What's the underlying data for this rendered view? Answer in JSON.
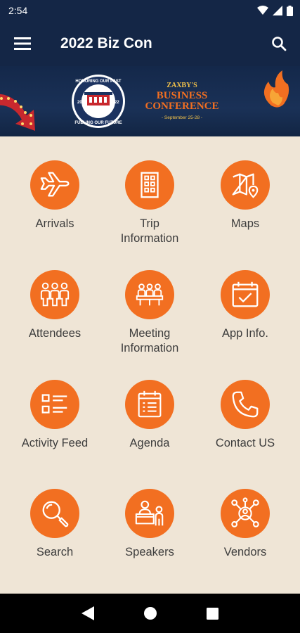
{
  "status_bar": {
    "time": "2:54",
    "icons": [
      "wifi-icon",
      "signal-icon",
      "battery-icon"
    ]
  },
  "app_bar": {
    "title": "2022 Biz Con",
    "menu_icon": "menu-icon",
    "search_icon": "search-icon"
  },
  "banner": {
    "seal_top_text": "HONORING OUR PAST",
    "seal_bottom_text": "FUELING OUR FUTURE",
    "seal_year_left": "20",
    "seal_year_right": "22",
    "brand": "ZAXBY'S",
    "line1": "BUSINESS",
    "line2": "CONFERENCE",
    "dates": "- September 25-28 -"
  },
  "colors": {
    "accent": "#f26f21",
    "header": "#142646",
    "background": "#efe5d6"
  },
  "tiles": [
    {
      "label": "Arrivals",
      "icon": "airplane-icon"
    },
    {
      "label": "Trip\nInformation",
      "icon": "building-icon"
    },
    {
      "label": "Maps",
      "icon": "map-icon"
    },
    {
      "label": "Attendees",
      "icon": "people-icon"
    },
    {
      "label": "Meeting\nInformation",
      "icon": "meeting-icon"
    },
    {
      "label": "App Info.",
      "icon": "calendar-check-icon"
    },
    {
      "label": "Activity Feed",
      "icon": "list-icon"
    },
    {
      "label": "Agenda",
      "icon": "agenda-icon"
    },
    {
      "label": "Contact US",
      "icon": "phone-icon"
    },
    {
      "label": "Search",
      "icon": "magnifier-icon"
    },
    {
      "label": "Speakers",
      "icon": "speaker-icon"
    },
    {
      "label": "Vendors",
      "icon": "network-icon"
    }
  ],
  "nav_bar": {
    "buttons": [
      "back-icon",
      "home-icon",
      "recents-icon"
    ]
  }
}
